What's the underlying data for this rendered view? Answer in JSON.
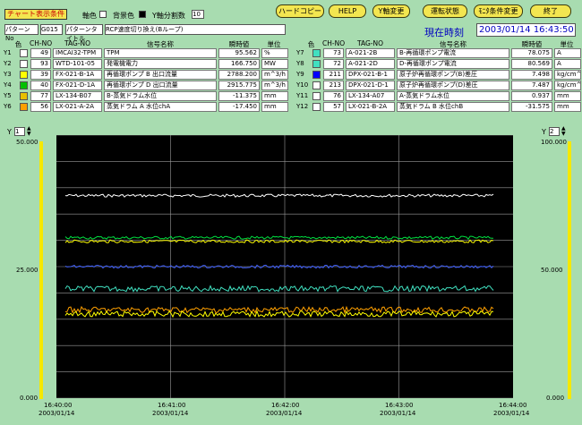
{
  "toolbar": {
    "title_tab": "チャート表示条件",
    "grid_label": "軸色",
    "bg_label": "背景色",
    "ydiv_label": "Y軸分割数",
    "ydiv_value": "10",
    "buttons": [
      "ハードコピー",
      "HELP",
      "Y軸変更",
      "運転状態",
      "ﾓﾆﾀ条件変更",
      "終了"
    ]
  },
  "pattern": {
    "no_label": "パターンNo",
    "no_value": "G015",
    "title_label": "パターンタイトル",
    "title_value": "RCP速度切り換え(Bループ)"
  },
  "clock": {
    "label": "現在時刻",
    "value": "2003/01/14 16:43:50"
  },
  "table_headers": {
    "color": "色",
    "chno": "CH-NO",
    "tag": "TAG-NO",
    "name": "信号名称",
    "value": "瞬時値",
    "unit": "単位"
  },
  "colors": {
    "bg": "#a8dcb0",
    "btn": "#f3e650",
    "axis": "#f5e800",
    "grid": "#9a9a9a"
  },
  "left_rows": [
    {
      "y": "Y1",
      "color": "#ffffff",
      "ch": "49",
      "tag": "IMCAI32-TPM",
      "name": "TPM",
      "value": "95.562",
      "unit": "%"
    },
    {
      "y": "Y2",
      "color": "#ffffff",
      "ch": "93",
      "tag": "WTD-101-05",
      "name": "発電機電力",
      "value": "166.750",
      "unit": "MW"
    },
    {
      "y": "Y3",
      "color": "#ffff00",
      "ch": "39",
      "tag": "FX-021-B-1A",
      "name": "再循環ポンプ B 出口流量",
      "value": "2788.200",
      "unit": "m^3/h"
    },
    {
      "y": "Y4",
      "color": "#00c000",
      "ch": "40",
      "tag": "FX-021-D-1A",
      "name": "再循環ポンプ D 出口流量",
      "value": "2915.775",
      "unit": "m^3/h"
    },
    {
      "y": "Y5",
      "color": "#e8c000",
      "ch": "77",
      "tag": "LX-134-B07",
      "name": "B-蒸気ドラム水位",
      "value": "-11.375",
      "unit": "mm"
    },
    {
      "y": "Y6",
      "color": "#ffa000",
      "ch": "56",
      "tag": "LX-021-A-2A",
      "name": "蒸気ドラム A 水位chA",
      "value": "-17.450",
      "unit": "mm"
    }
  ],
  "right_rows": [
    {
      "y": "Y7",
      "color": "#40e0c0",
      "ch": "73",
      "tag": "A-021-2B",
      "name": "B-再循環ポンプ電流",
      "value": "78.075",
      "unit": "A"
    },
    {
      "y": "Y8",
      "color": "#40e0c0",
      "ch": "72",
      "tag": "A-021-2D",
      "name": "D-再循環ポンプ電流",
      "value": "80.569",
      "unit": "A"
    },
    {
      "y": "Y9",
      "color": "#0000ff",
      "ch": "211",
      "tag": "DPX-021-B-1",
      "name": "原子炉再循環ポンプ(B)差圧",
      "value": "7.498",
      "unit": "kg/cm^2"
    },
    {
      "y": "Y10",
      "color": "#ffffff",
      "ch": "213",
      "tag": "DPX-021-D-1",
      "name": "原子炉再循環ポンプ(D)差圧",
      "value": "7.487",
      "unit": "kg/cm^2"
    },
    {
      "y": "Y11",
      "color": "#ffffff",
      "ch": "76",
      "tag": "LX-134-A07",
      "name": "A-蒸気ドラム水位",
      "value": "0.937",
      "unit": "mm"
    },
    {
      "y": "Y12",
      "color": "#ffffff",
      "ch": "57",
      "tag": "LX-021-B-2A",
      "name": "蒸気ドラム B 水位chB",
      "value": "-31.575",
      "unit": "mm"
    }
  ],
  "axis": {
    "left_sel_label": "Y",
    "left_sel": "1",
    "right_sel_label": "Y",
    "right_sel": "2",
    "left_ticks": [
      "50.000",
      "25.000",
      "0.000"
    ],
    "right_ticks": [
      "100.000",
      "50.000",
      "0.000"
    ]
  },
  "chart_data": {
    "type": "line",
    "xlabel": "",
    "ylabel": "",
    "x": [
      "16:40:00",
      "16:41:00",
      "16:42:00",
      "16:43:00",
      "16:44:00"
    ],
    "x_dates": [
      "2003/01/14",
      "2003/01/14",
      "2003/01/14",
      "2003/01/14",
      "2003/01/14"
    ],
    "ylim": [
      0,
      50
    ],
    "series": [
      {
        "color": "#ffffff",
        "level": 38.5
      },
      {
        "color": "#00e040",
        "level": 30.5
      },
      {
        "color": "#ffff00",
        "level": 29.8
      },
      {
        "color": "#4060ff",
        "level": 25.0
      },
      {
        "color": "#40e0c0",
        "level": 20.8
      },
      {
        "color": "#ffa000",
        "level": 16.8
      },
      {
        "color": "#ffff00",
        "level": 16.0
      }
    ]
  }
}
